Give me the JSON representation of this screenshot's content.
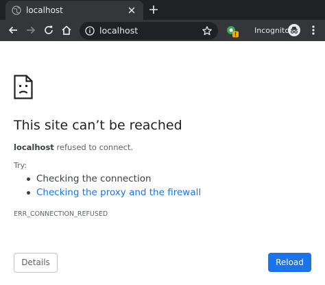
{
  "browser": {
    "tab": {
      "title": "localhost",
      "favicon": "globe-icon"
    },
    "omnibox": {
      "url": "localhost"
    },
    "incognito_label": "Incognito",
    "extension_badge": "!"
  },
  "error_page": {
    "title": "This site can’t be reached",
    "host": "localhost",
    "message": "refused to connect.",
    "try_label": "Try:",
    "suggestions": [
      {
        "text": "Checking the connection",
        "is_link": false
      },
      {
        "text": "Checking the proxy and the firewall",
        "is_link": true
      }
    ],
    "error_code": "ERR_CONNECTION_REFUSED",
    "buttons": {
      "details": "Details",
      "reload": "Reload"
    }
  },
  "colors": {
    "chrome_dark": "#202124",
    "chrome_toolbar": "#35363a",
    "link": "#1a73e8",
    "primary_button": "#1a73e8",
    "text_primary": "#202124",
    "text_secondary": "#5f6368"
  }
}
